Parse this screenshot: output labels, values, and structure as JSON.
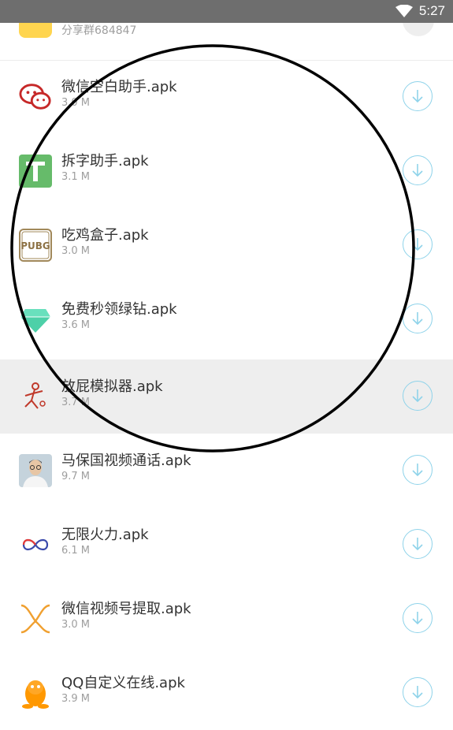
{
  "status_bar": {
    "time": "5:27"
  },
  "top_item": {
    "subtitle": "分享群684847"
  },
  "items": [
    {
      "name": "微信空白助手.apk",
      "size": "3.0 M",
      "icon": "wechat-icon"
    },
    {
      "name": "拆字助手.apk",
      "size": "3.1 M",
      "icon": "split-char-icon"
    },
    {
      "name": "吃鸡盒子.apk",
      "size": "3.0 M",
      "icon": "pubg-icon",
      "icon_text": "PUBG"
    },
    {
      "name": "免费秒领绿钻.apk",
      "size": "3.6 M",
      "icon": "green-diamond-icon"
    },
    {
      "name": "放屁模拟器.apk",
      "size": "3.7 M",
      "icon": "runner-icon"
    },
    {
      "name": "马保国视频通话.apk",
      "size": "9.7 M",
      "icon": "portrait-icon"
    },
    {
      "name": "无限火力.apk",
      "size": "6.1 M",
      "icon": "infinity-icon"
    },
    {
      "name": "微信视频号提取.apk",
      "size": "3.0 M",
      "icon": "video-channel-icon"
    },
    {
      "name": "QQ自定义在线.apk",
      "size": "3.9 M",
      "icon": "qq-penguin-icon"
    }
  ],
  "colors": {
    "download_ring": "#8fd3ea",
    "highlight_row": "#eeeeee",
    "status_bar": "#6e6e6e"
  }
}
